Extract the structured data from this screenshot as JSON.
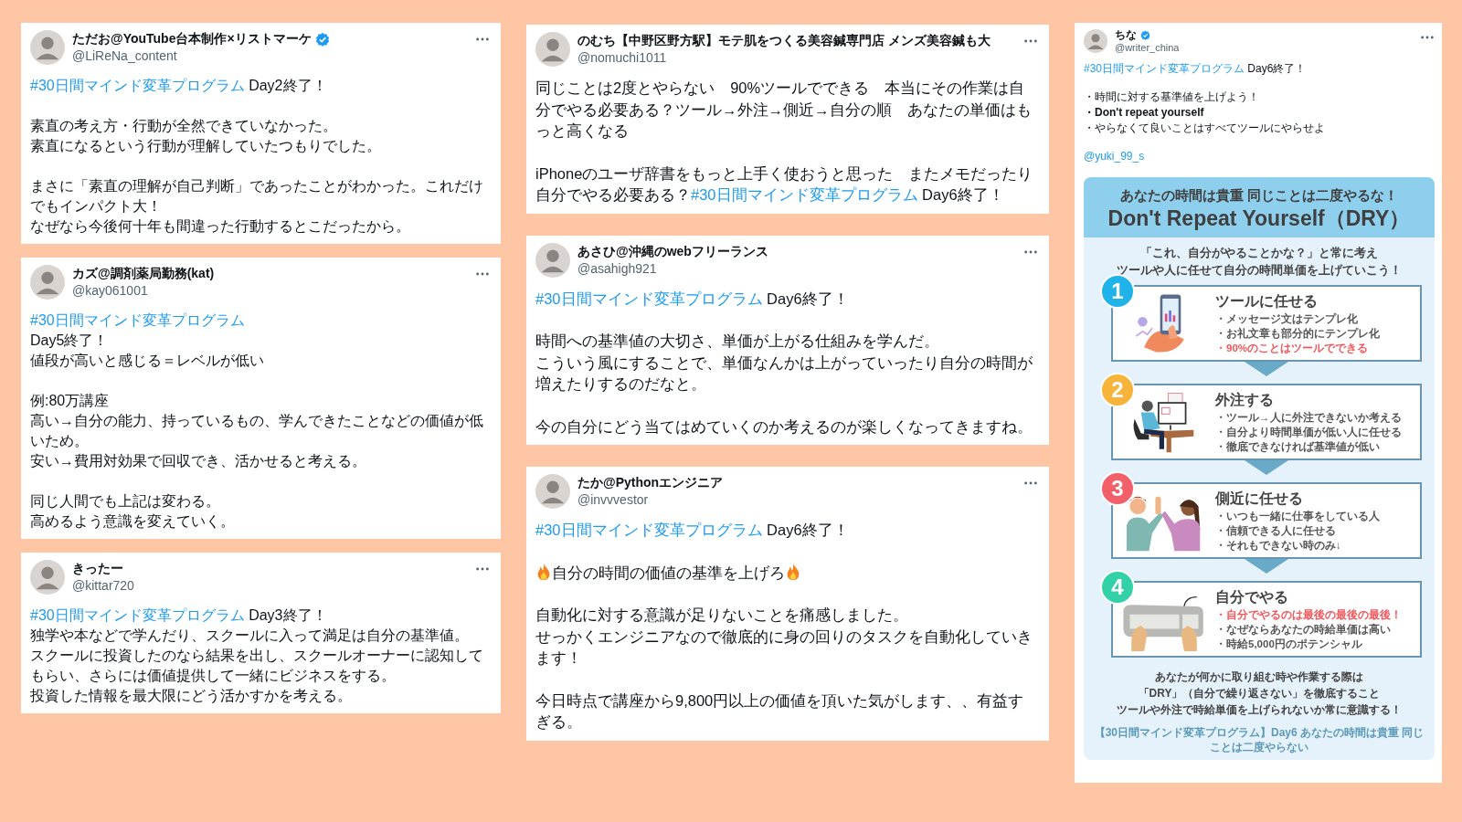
{
  "columns": [
    {
      "tweets": [
        {
          "name": "ただお@YouTube台本制作×リストマーケ",
          "verified": true,
          "handle": "@LiReNa_content",
          "paragraphs": [
            [
              [
                {
                  "kind": "hashtag",
                  "text": "#30日間マインド変革プログラム"
                },
                {
                  "kind": "text",
                  "text": " Day2終了！"
                }
              ]
            ],
            [
              [
                {
                  "kind": "text",
                  "text": "素直の考え方・行動が全然できていなかった。"
                }
              ],
              [
                {
                  "kind": "text",
                  "text": "素直になるという行動が理解していたつもりでした。"
                }
              ]
            ],
            [
              [
                {
                  "kind": "text",
                  "text": "まさに「素直の理解が自己判断」であったことがわかった。これだけでもインパクト大！"
                }
              ],
              [
                {
                  "kind": "text",
                  "text": "なぜなら今後何十年も間違った行動するとこだったから。"
                }
              ]
            ]
          ]
        },
        {
          "name": "カズ@調剤薬局勤務(kat)",
          "verified": false,
          "handle": "@kay061001",
          "paragraphs": [
            [
              [
                {
                  "kind": "hashtag",
                  "text": "#30日間マインド変革プログラム"
                }
              ],
              [
                {
                  "kind": "text",
                  "text": "Day5終了！"
                }
              ],
              [
                {
                  "kind": "text",
                  "text": "値段が高いと感じる＝レベルが低い"
                }
              ]
            ],
            [
              [
                {
                  "kind": "text",
                  "text": "例:80万講座"
                }
              ],
              [
                {
                  "kind": "text",
                  "text": "高い→自分の能力、持っているもの、学んできたことなどの価値が低いため。"
                }
              ],
              [
                {
                  "kind": "text",
                  "text": "安い→費用対効果で回収でき、活かせると考える。"
                }
              ]
            ],
            [
              [
                {
                  "kind": "text",
                  "text": "同じ人間でも上記は変わる。"
                }
              ],
              [
                {
                  "kind": "text",
                  "text": "高めるよう意識を変えていく。"
                }
              ]
            ]
          ]
        },
        {
          "name": "きったー",
          "verified": false,
          "handle": "@kittar720",
          "paragraphs": [
            [
              [
                {
                  "kind": "hashtag",
                  "text": "#30日間マインド変革プログラム"
                },
                {
                  "kind": "text",
                  "text": " Day3終了！"
                }
              ],
              [
                {
                  "kind": "text",
                  "text": "独学や本などで学んだり、スクールに入って満足は自分の基準値。"
                }
              ],
              [
                {
                  "kind": "text",
                  "text": "スクールに投資したのなら結果を出し、スクールオーナーに認知してもらい、さらには価値提供して一緒にビジネスをする。"
                }
              ],
              [
                {
                  "kind": "text",
                  "text": "投資した情報を最大限にどう活かすかを考える。"
                }
              ]
            ]
          ]
        }
      ]
    },
    {
      "tweets": [
        {
          "name": "のむち【中野区野方駅】モテ肌をつくる美容鍼専門店 メンズ美容鍼も大",
          "verified": false,
          "handle": "@nomuchi1011",
          "paragraphs": [
            [
              [
                {
                  "kind": "text",
                  "text": "同じことは2度とやらない　90%ツールでできる　本当にその作業は自分でやる必要ある？ツール→外注→側近→自分の順　あなたの単価はもっと高くなる"
                }
              ]
            ],
            [
              [
                {
                  "kind": "text",
                  "text": "iPhoneのユーザ辞書をもっと上手く使おうと思った　またメモだったり自分でやる必要ある？"
                },
                {
                  "kind": "hashtag",
                  "text": "#30日間マインド変革プログラム"
                },
                {
                  "kind": "text",
                  "text": " Day6終了！"
                }
              ]
            ]
          ]
        },
        {
          "name": "あさひ@沖縄のwebフリーランス",
          "verified": false,
          "handle": "@asahigh921",
          "paragraphs": [
            [
              [
                {
                  "kind": "hashtag",
                  "text": "#30日間マインド変革プログラム"
                },
                {
                  "kind": "text",
                  "text": " Day6終了！"
                }
              ]
            ],
            [
              [
                {
                  "kind": "text",
                  "text": "時間への基準値の大切さ、単価が上がる仕組みを学んだ。"
                }
              ],
              [
                {
                  "kind": "text",
                  "text": "こういう風にすることで、単価なんかは上がっていったり自分の時間が増えたりするのだなと。"
                }
              ]
            ],
            [
              [
                {
                  "kind": "text",
                  "text": "今の自分にどう当てはめていくのか考えるのが楽しくなってきますね。"
                }
              ]
            ]
          ]
        },
        {
          "name": "たか@Pythonエンジニア",
          "verified": false,
          "handle": "@invvvestor",
          "paragraphs": [
            [
              [
                {
                  "kind": "hashtag",
                  "text": "#30日間マインド変革プログラム"
                },
                {
                  "kind": "text",
                  "text": " Day6終了！"
                }
              ]
            ],
            [
              [
                {
                  "kind": "emoji"
                },
                {
                  "kind": "text",
                  "text": "自分の時間の価値の基準を上げろ"
                },
                {
                  "kind": "emoji"
                }
              ]
            ],
            [
              [
                {
                  "kind": "text",
                  "text": "自動化に対する意識が足りないことを痛感しました。"
                }
              ],
              [
                {
                  "kind": "text",
                  "text": "せっかくエンジニアなので徹底的に身の回りのタスクを自動化していきます！"
                }
              ]
            ],
            [
              [
                {
                  "kind": "text",
                  "text": "今日時点で講座から9,800円以上の価値を頂いた気がします、、有益すぎる。"
                }
              ]
            ]
          ]
        }
      ]
    },
    {
      "tweets": [
        {
          "name": "ちな",
          "verified": true,
          "handle": "@writer_china",
          "paragraphs": [
            [
              [
                {
                  "kind": "hashtag",
                  "text": "#30日間マインド変革プログラム"
                },
                {
                  "kind": "text",
                  "text": " Day6終了！"
                }
              ]
            ],
            [
              [
                {
                  "kind": "text",
                  "text": "・時間に対する基準値を上げよう！"
                }
              ],
              [
                {
                  "kind": "bold",
                  "text": "・Don't repeat yourself"
                }
              ],
              [
                {
                  "kind": "text",
                  "text": "・やらなくて良いことはすべてツールにやらせよ"
                }
              ]
            ],
            [
              [
                {
                  "kind": "mention",
                  "text": "@yuki_99_s"
                }
              ]
            ]
          ],
          "infographic": {
            "headline": "あなたの時間は貴重 同じことは二度やるな！",
            "title": "Don't Repeat Yourself（DRY）",
            "intro": [
              "「これ、自分がやることかな？」と常に考え",
              "ツールや人に任せて自分の時間単価を上げていこう！"
            ],
            "steps": [
              {
                "number": "1",
                "color": "#1fb3ea",
                "kind": "phone",
                "title": "ツールに任せる",
                "bullets": [
                  {
                    "text": "・メッセージ文はテンプレ化",
                    "highlight": false
                  },
                  {
                    "text": "・お礼文章も部分的にテンプレ化",
                    "highlight": false
                  },
                  {
                    "text": "・90%のことはツールでできる",
                    "highlight": true
                  }
                ]
              },
              {
                "number": "2",
                "color": "#f6b53a",
                "kind": "desk",
                "title": "外注する",
                "bullets": [
                  {
                    "text": "・ツール→人に外注できないか考える",
                    "highlight": false
                  },
                  {
                    "text": "・自分より時間単価が低い人に任せる",
                    "highlight": false
                  },
                  {
                    "text": "・徹底できなければ基準値が低い",
                    "highlight": false
                  }
                ]
              },
              {
                "number": "3",
                "color": "#f2606a",
                "kind": "high-five",
                "title": "側近に任せる",
                "bullets": [
                  {
                    "text": "・いつも一緒に仕事をしている人",
                    "highlight": false
                  },
                  {
                    "text": "・信頼できる人に任せる",
                    "highlight": false
                  },
                  {
                    "text": "・それもできない時のみ↓",
                    "highlight": false
                  }
                ]
              },
              {
                "number": "4",
                "color": "#33d1a8",
                "kind": "keyboard",
                "title": "自分でやる",
                "bullets": [
                  {
                    "text": "・自分でやるのは最後の最後の最後！",
                    "highlight": true
                  },
                  {
                    "text": "・なぜならあなたの時給単価は高い",
                    "highlight": false
                  },
                  {
                    "text": "・時給5,000円のポテンシャル",
                    "highlight": false
                  }
                ]
              }
            ],
            "summary": [
              "あなたが何かに取り組む時や作業する際は",
              "「DRY」（自分で繰り返さない」を徹底すること",
              "ツールや外注で時給単価を上げられないか常に意識する！"
            ],
            "caption": "【30日間マインド変革プログラム】Day6 あなたの時間は貴重 同じことは二度やらない"
          }
        }
      ]
    }
  ]
}
